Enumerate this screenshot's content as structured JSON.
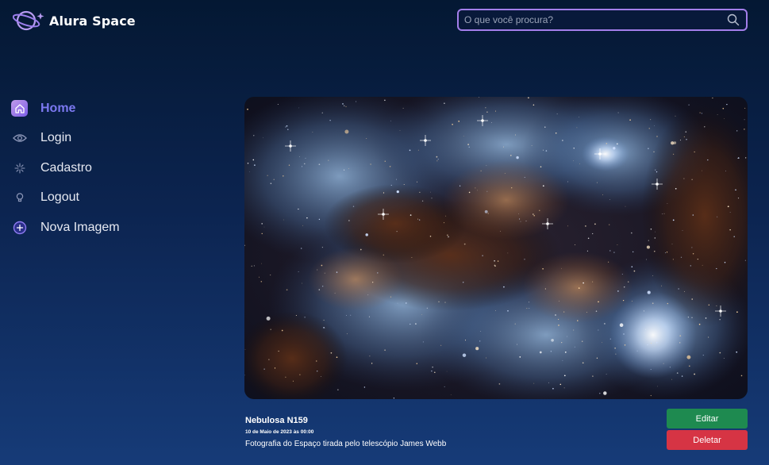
{
  "header": {
    "logo_text": "Alura Space",
    "search_placeholder": "O que você procura?"
  },
  "sidebar": {
    "items": [
      {
        "label": "Home",
        "icon": "home-icon",
        "active": true
      },
      {
        "label": "Login",
        "icon": "eye-icon",
        "active": false
      },
      {
        "label": "Cadastro",
        "icon": "sparkle-icon",
        "active": false
      },
      {
        "label": "Logout",
        "icon": "bulb-icon",
        "active": false
      },
      {
        "label": "Nova Imagem",
        "icon": "plus-circle-icon",
        "active": false
      }
    ]
  },
  "photo": {
    "title": "Nebulosa N159",
    "date": "10 de Maio de 2023 às 00:00",
    "description": "Fotografia do Espaço tirada pelo telescópio James Webb"
  },
  "actions": {
    "edit_label": "Editar",
    "delete_label": "Deletar"
  },
  "colors": {
    "accent": "#a37eea",
    "active_nav": "#7b78f0",
    "edit": "#1e8a50",
    "delete": "#d63444"
  }
}
